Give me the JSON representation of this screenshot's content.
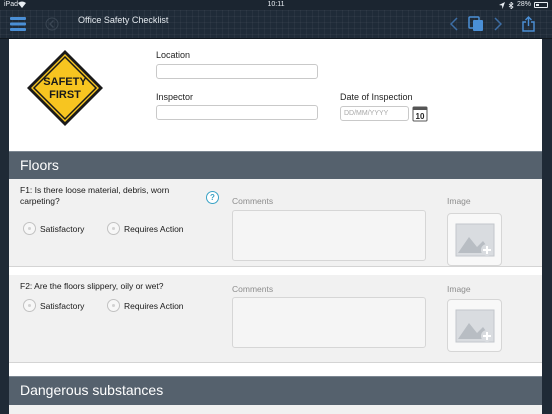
{
  "status_bar": {
    "carrier": "iPad",
    "time": "10:11",
    "battery": "28%"
  },
  "toolbar": {
    "title": "Office Safety Checklist",
    "icons": [
      "list-icon",
      "back-arrow-icon",
      "chevron-left-icon",
      "pages-icon",
      "chevron-right-icon",
      "share-icon"
    ]
  },
  "header": {
    "logo_text": [
      "SAFETY",
      "FIRST"
    ],
    "location_label": "Location",
    "location_value": "",
    "inspector_label": "Inspector",
    "inspector_value": "",
    "date_label": "Date of Inspection",
    "date_placeholder": "DD/MM/YYYY",
    "calendar_day": "10"
  },
  "sections": [
    {
      "title": "Floors",
      "questions": [
        {
          "text": "F1: Is there loose material, debris, worn carpeting?",
          "has_help": true,
          "options": [
            "Satisfactory",
            "Requires Action"
          ],
          "comments_label": "Comments",
          "image_label": "Image"
        },
        {
          "text": "F2: Are the floors slippery, oily or wet?",
          "has_help": false,
          "options": [
            "Satisfactory",
            "Requires Action"
          ],
          "comments_label": "Comments",
          "image_label": "Image"
        }
      ]
    },
    {
      "title": "Dangerous substances",
      "questions": []
    }
  ],
  "colors": {
    "toolbar_bg": "#1f2b38",
    "section_header_bg": "#55616d",
    "row_bg": "#f1f1f1",
    "accent_blue": "#3aa3c6",
    "sign_yellow": "#f7c520"
  }
}
